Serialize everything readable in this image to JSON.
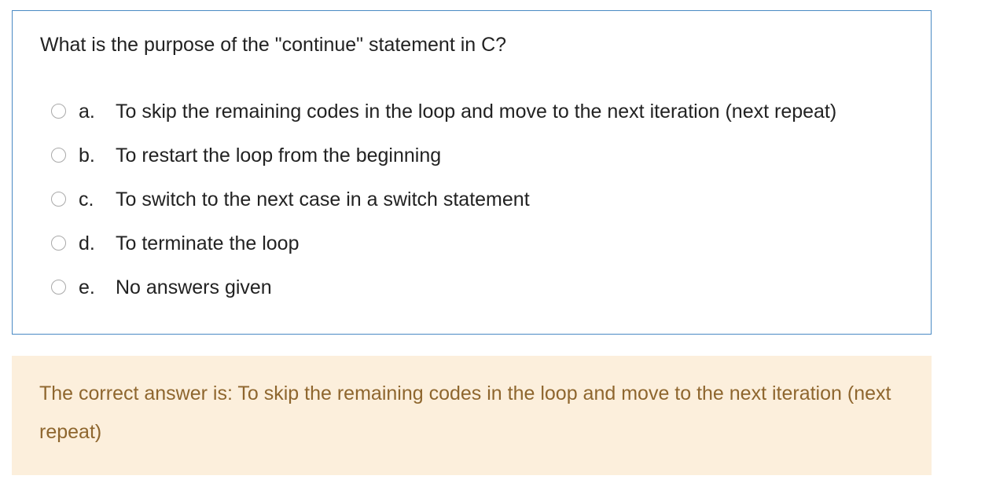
{
  "question": {
    "text": "What is the purpose of the \"continue\" statement in C?"
  },
  "answers": [
    {
      "letter": "a.",
      "text": "To skip the remaining codes in the loop and move to the next iteration (next repeat)",
      "selected": false
    },
    {
      "letter": "b.",
      "text": "To restart the loop from the beginning",
      "selected": false
    },
    {
      "letter": "c.",
      "text": "To switch to the next case in a switch statement",
      "selected": false
    },
    {
      "letter": "d.",
      "text": "To terminate the loop",
      "selected": false
    },
    {
      "letter": "e.",
      "text": "No answers given",
      "selected": false
    }
  ],
  "feedback": {
    "text": "The correct answer is: To skip the remaining codes in the loop and move to the next iteration (next repeat)"
  },
  "colors": {
    "question_border": "#4a8ac4",
    "feedback_background": "#fcefdc",
    "feedback_text": "#8e662e"
  }
}
